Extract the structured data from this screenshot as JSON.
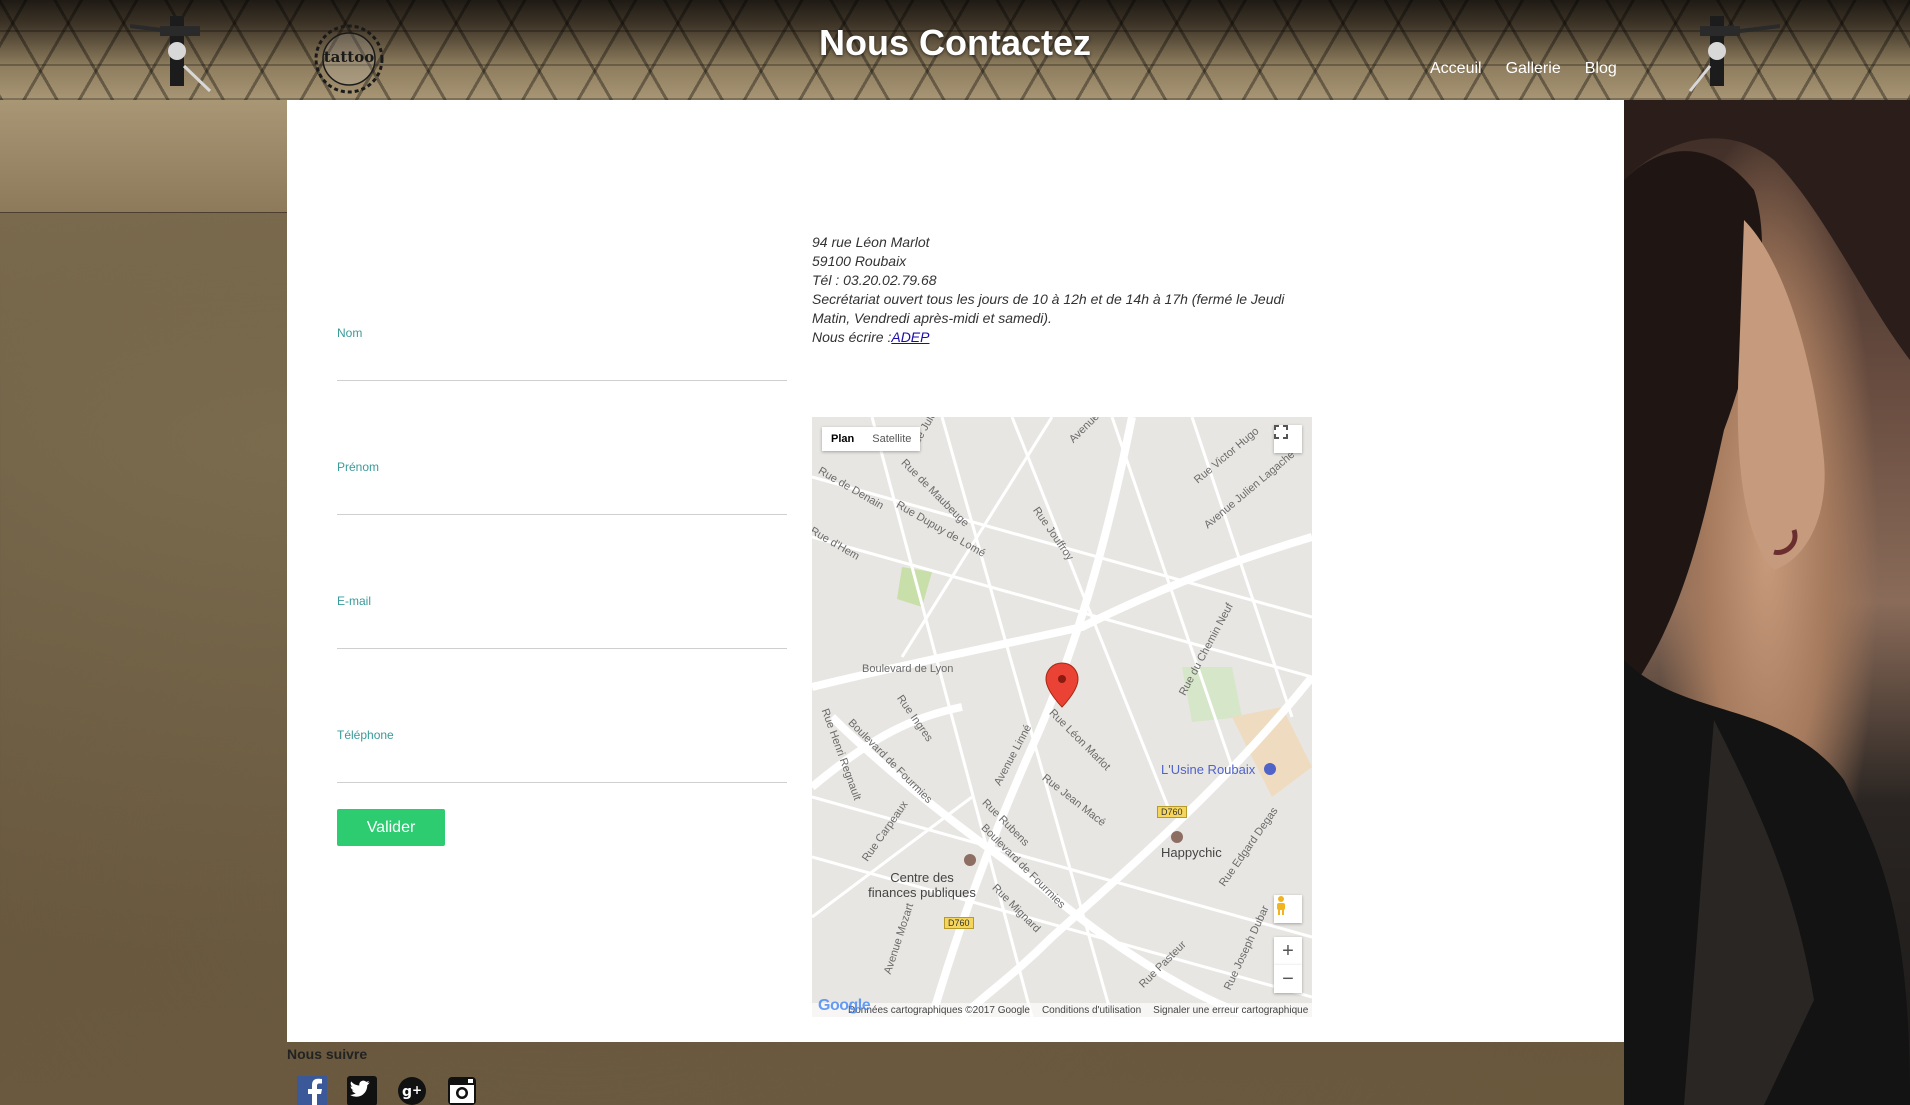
{
  "header": {
    "title": "Nous Contactez",
    "logo_text": "tattoo",
    "nav": [
      {
        "label": "Acceuil"
      },
      {
        "label": "Gallerie"
      },
      {
        "label": "Blog"
      }
    ]
  },
  "form": {
    "fields": [
      {
        "label": "Nom",
        "value": ""
      },
      {
        "label": "Prénom",
        "value": ""
      },
      {
        "label": "E-mail",
        "value": ""
      },
      {
        "label": "Téléphone",
        "value": ""
      }
    ],
    "submit_label": "Valider",
    "submit_color": "#2ecc71",
    "label_color": "#3a9a9a"
  },
  "address": {
    "line1": "94 rue Léon Marlot",
    "line2": "59100 Roubaix",
    "phone": "Tél : 03.20.02.79.68",
    "hours": "Secrétariat ouvert tous les jours de 10 à 12h et de 14h à 17h (fermé le Jeudi Matin, Vendredi après-midi et samedi).",
    "write_prefix": "Nous écrire :",
    "write_link": "ADEP"
  },
  "map": {
    "tabs": [
      "Plan",
      "Satellite"
    ],
    "active_tab": "Plan",
    "labels": {
      "boulevard_lyon": "Boulevard de Lyon",
      "rue_ingres": "Rue Ingres",
      "rue_leon_marlot": "Rue Léon Marlot",
      "avenue_linne": "Avenue Linné",
      "rue_jean_mace": "Rue Jean Macé",
      "rue_rubens": "Rue Rubens",
      "bd_fourmies": "Boulevard de Fourmies",
      "rue_mignard": "Rue Mignard",
      "rue_henri_regnault": "Rue Henri Regnault",
      "rue_carpeaux": "Rue Carpeaux",
      "avenue_mozart": "Avenue Mozart",
      "rue_dupuy_lome": "Rue Dupuy de Lomé",
      "rue_maubeuge": "Rue de Maubeuge",
      "rue_denain": "Rue de Denain",
      "rue_hem": "Rue d'Hem",
      "rue_jouffroy": "Rue Jouffroy",
      "avenue_lannoy": "Avenue de Lannoy",
      "rue_victor_hugo": "Rue Victor Hugo",
      "avenue_julien_lagache": "Avenue Julien Lagache",
      "rue_chemin_neuf": "Rue du Chemin Neuf",
      "rue_edgard_degas": "Rue Edgard Degas",
      "rue_pasteur": "Rue Pasteur",
      "rue_joseph_dubar": "Rue Joseph Dubar",
      "rue_jules_guesde": "Rue Jules Guesde",
      "usine_roubaix": "L'Usine Roubaix",
      "happychic": "Happychic",
      "centre_finances": "Centre des finances publiques",
      "d760": "D760"
    },
    "copyright": "Données cartographiques ©2017 Google",
    "terms": "Conditions d'utilisation",
    "report": "Signaler une erreur cartographique",
    "google_logo": "Google",
    "zoom_in": "+",
    "zoom_out": "−"
  },
  "footer": {
    "follow_label": "Nous suivre",
    "socials": [
      "facebook-icon",
      "twitter-icon",
      "google-plus-icon",
      "instagram-icon"
    ]
  }
}
